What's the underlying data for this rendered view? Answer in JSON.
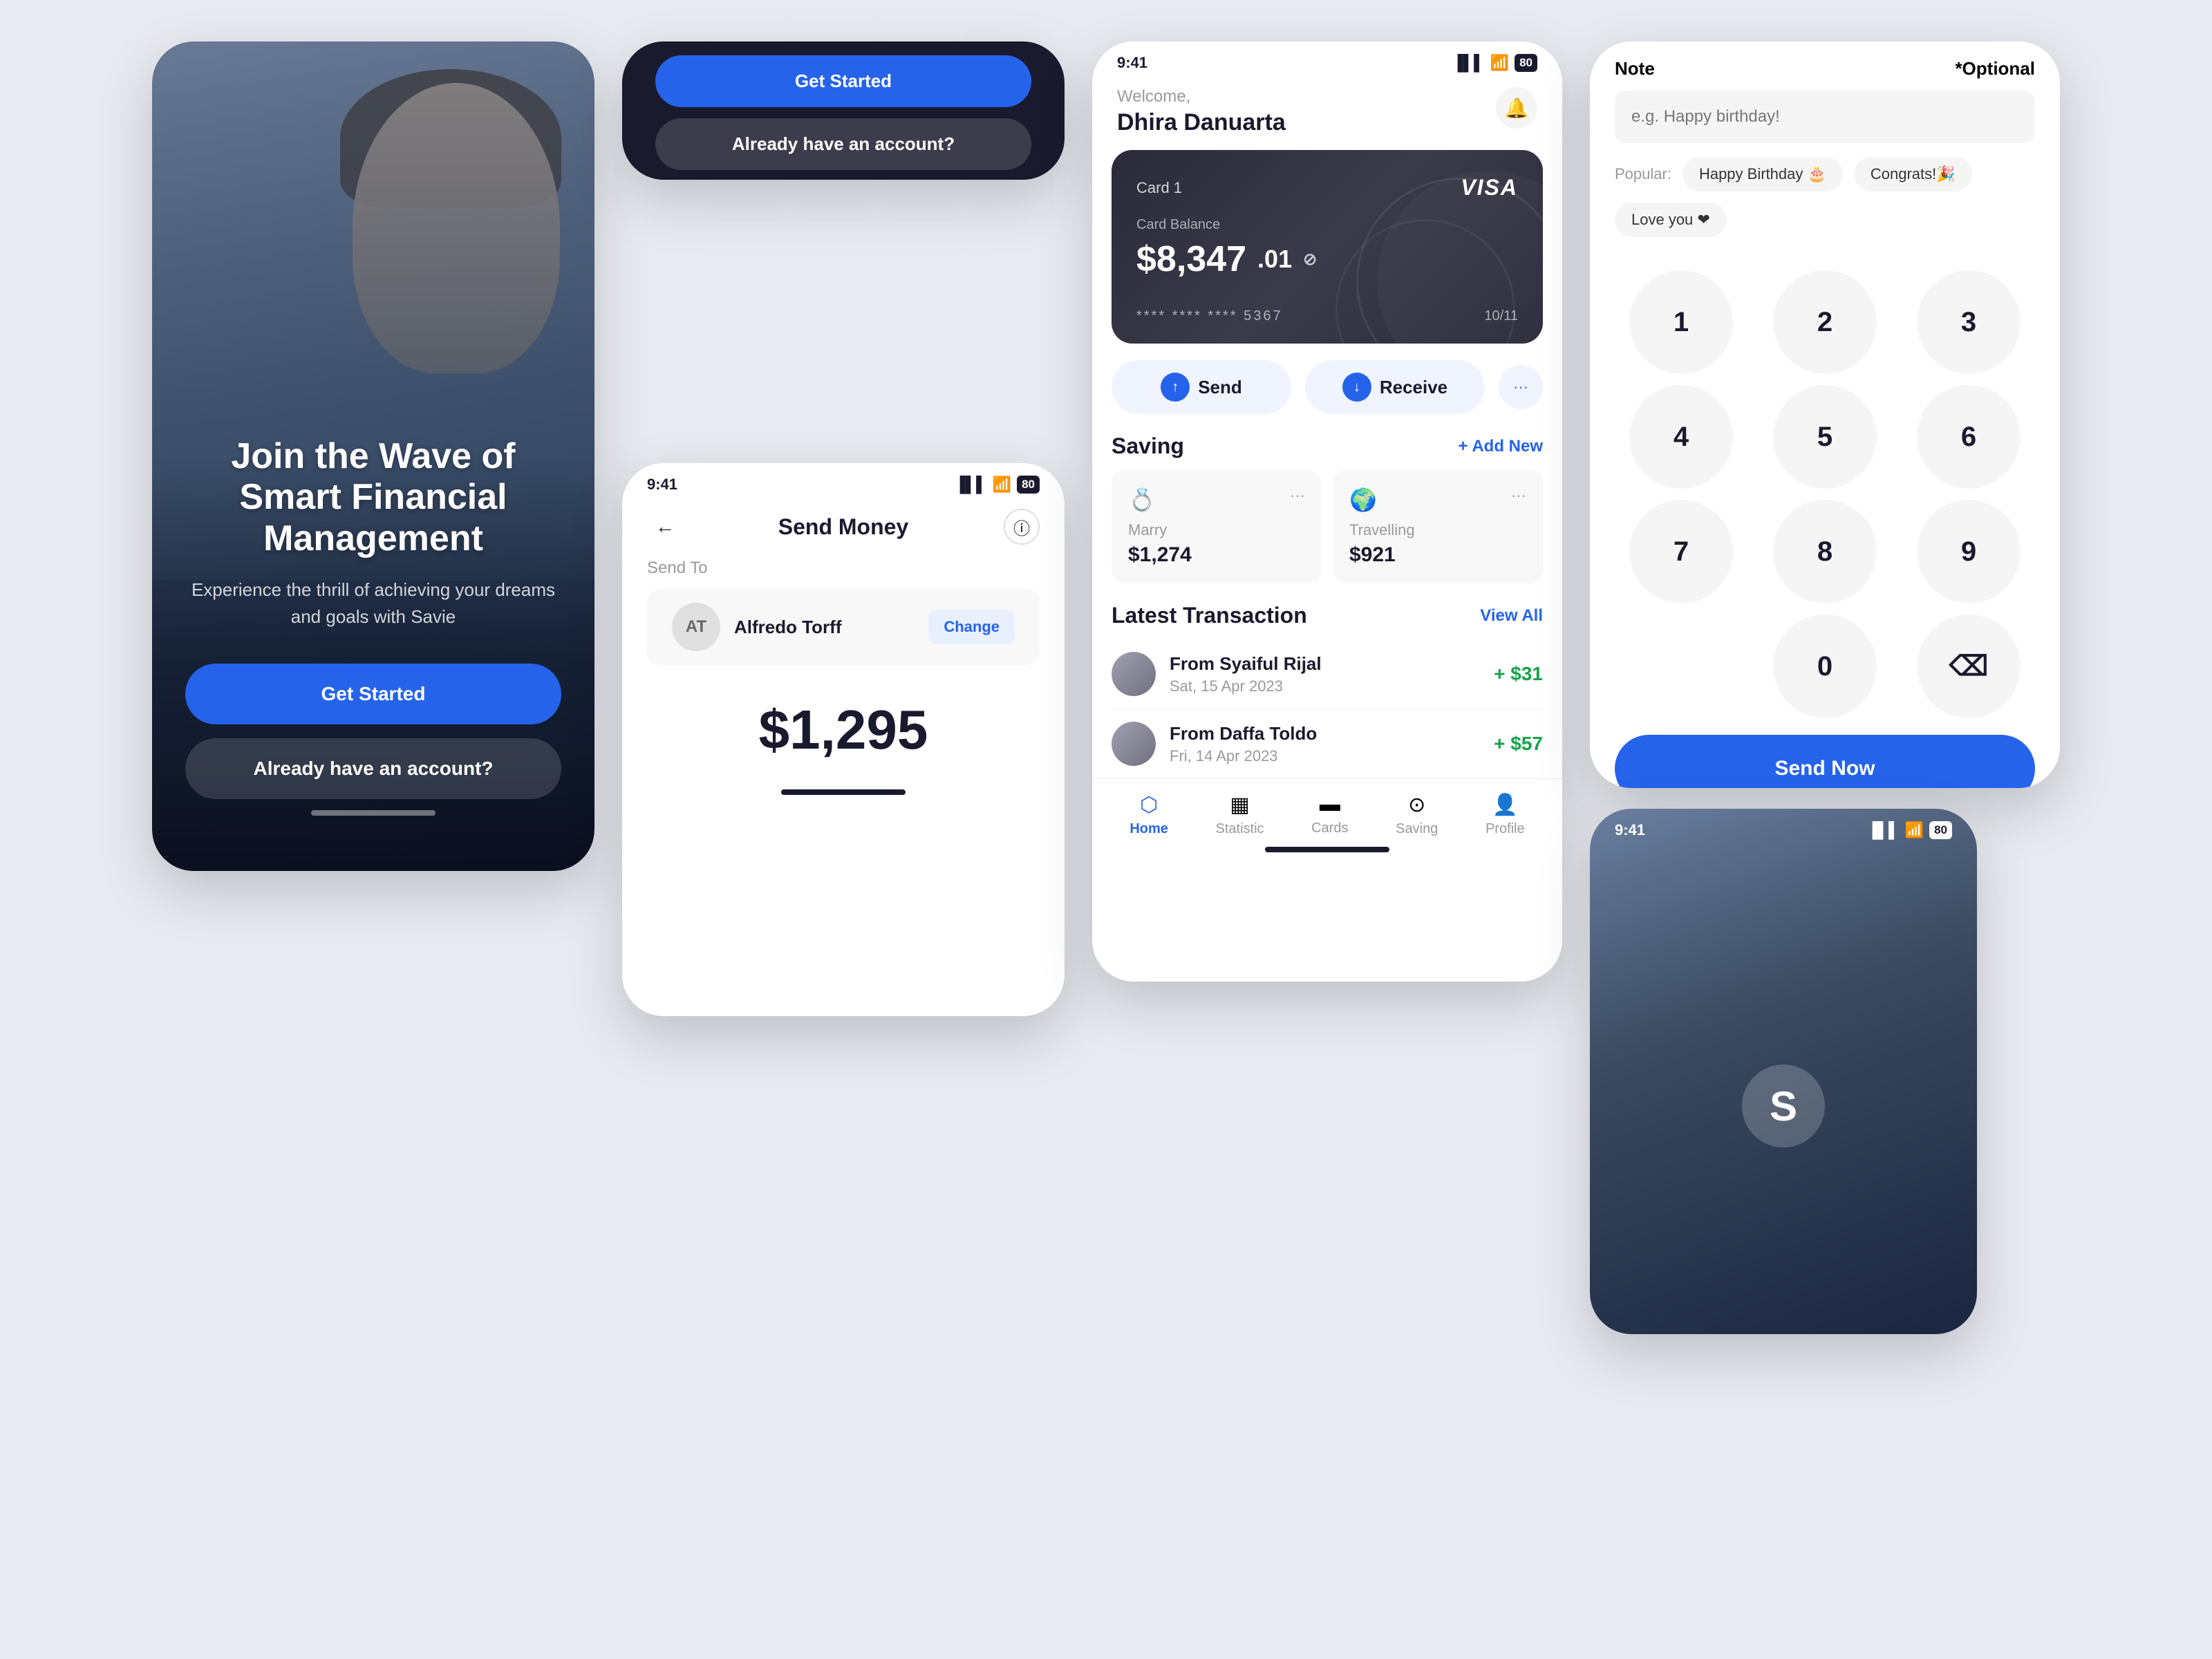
{
  "phone1": {
    "title": "Join the Wave of Smart Financial Management",
    "subtitle": "Experience the thrill of achieving your dreams and goals with Savie",
    "get_started": "Get Started",
    "already_account": "Already have an account?"
  },
  "phone2": {
    "status_time": "9:41",
    "battery": "80",
    "title": "Send Money",
    "send_to": "Send To",
    "recipient_initials": "AT",
    "recipient_name": "Alfredo Torff",
    "change_label": "Change",
    "amount": "$1,295"
  },
  "phone3": {
    "status_time": "9:41",
    "battery": "80",
    "welcome": "Welcome,",
    "user_name": "Dhira Danuarta",
    "card_name": "Card 1",
    "visa": "VISA",
    "balance_label": "Card Balance",
    "balance_main": "$8,347",
    "balance_cents": ".01",
    "card_number": "**** **** **** 5367",
    "card_expiry": "10/11",
    "send_label": "Send",
    "receive_label": "Receive",
    "saving_title": "Saving",
    "add_new": "+ Add New",
    "saving1_icon": "💍",
    "saving1_label": "Marry",
    "saving1_amount": "$1,274",
    "saving2_icon": "🌍",
    "saving2_label": "Travelling",
    "saving2_amount": "$921",
    "latest_tx_title": "Latest Transaction",
    "view_all": "View All",
    "tx1_name": "From Syaiful Rijal",
    "tx1_date": "Sat, 15 Apr 2023",
    "tx1_amount": "+ $31",
    "tx2_name": "From Daffa Toldo",
    "tx2_date": "Fri, 14 Apr 2023",
    "tx2_amount": "+ $57",
    "tab_home": "Home",
    "tab_statistic": "Statistic",
    "tab_cards": "Cards",
    "tab_saving": "Saving",
    "tab_profile": "Profile"
  },
  "phone4": {
    "note_label": "Note",
    "note_optional": "*Optional",
    "note_placeholder": "e.g. Happy birthday!",
    "popular_label": "Popular:",
    "tag1": "Happy Birthday 🎂",
    "tag2": "Congrats!🎉",
    "tag3": "Love you ❤",
    "keys": [
      "1",
      "2",
      "3",
      "4",
      "5",
      "6",
      "7",
      "8",
      "9",
      "0",
      "⌫"
    ],
    "send_now": "Send Now"
  },
  "phone5": {
    "status_time": "9:41",
    "battery": "80"
  }
}
